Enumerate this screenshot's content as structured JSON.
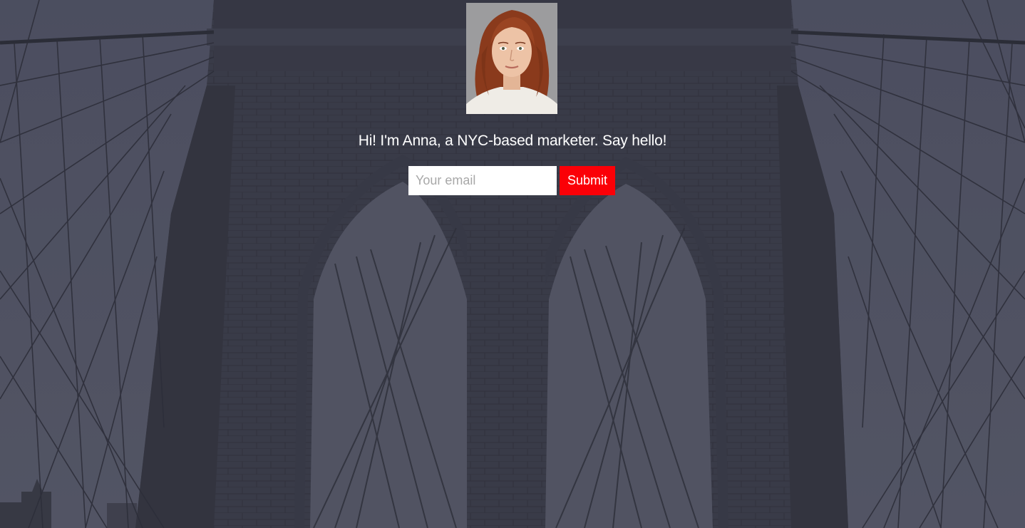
{
  "intro": {
    "headline": "Hi! I'm Anna, a NYC-based marketer. Say hello!"
  },
  "signup_form": {
    "email_placeholder": "Your email",
    "email_value": "",
    "submit_label": "Submit"
  },
  "colors": {
    "submit_background": "#fb0007",
    "text": "#ffffff",
    "overlay": "#4a4c58"
  },
  "icons": {
    "avatar": "portrait-photo",
    "background": "bridge-photo"
  }
}
